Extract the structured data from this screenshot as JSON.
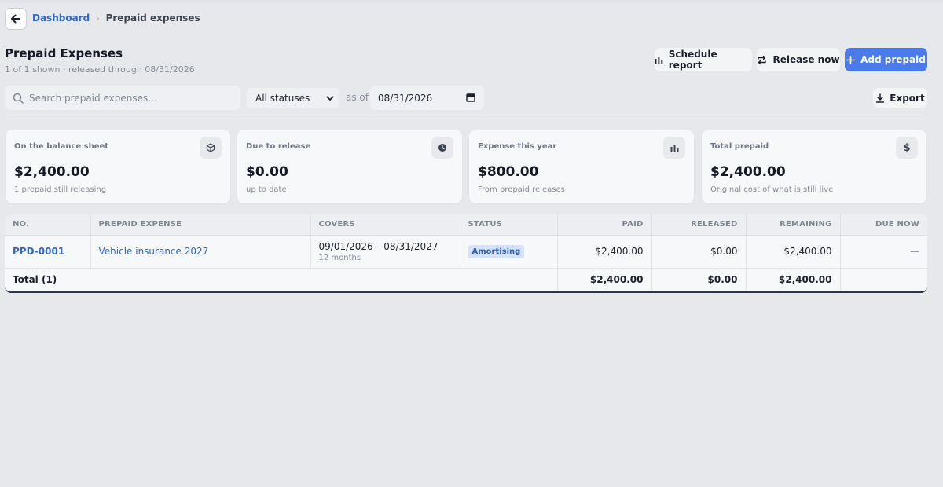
{
  "breadcrumb": {
    "root": "Dashboard",
    "separator": "›",
    "current": "Prepaid expenses"
  },
  "header": {
    "title": "Prepaid Expenses",
    "subtitle": "1 of 1 shown · released through 08/31/2026"
  },
  "actions": {
    "schedule_report": "Schedule report",
    "release_now": "Release now",
    "add_prepaid": "Add prepaid",
    "export": "Export"
  },
  "filters": {
    "search_placeholder": "Search prepaid expenses...",
    "status_selected": "All statuses",
    "as_of_label": "as of",
    "as_of_date": "08/31/2026"
  },
  "cards": [
    {
      "label": "On the balance sheet",
      "value": "$2,400.00",
      "note": "1 prepaid still releasing",
      "icon": "box-icon"
    },
    {
      "label": "Due to release",
      "value": "$0.00",
      "note": "up to date",
      "icon": "clock-icon"
    },
    {
      "label": "Expense this year",
      "value": "$800.00",
      "note": "From prepaid releases",
      "icon": "bar-chart-icon"
    },
    {
      "label": "Total prepaid",
      "value": "$2,400.00",
      "note": "Original cost of what is still live",
      "icon": "dollar-icon"
    }
  ],
  "table": {
    "columns": [
      "NO.",
      "PREPAID EXPENSE",
      "COVERS",
      "STATUS",
      "PAID",
      "RELEASED",
      "REMAINING",
      "DUE NOW"
    ],
    "rows": [
      {
        "no": "PPD-0001",
        "name": "Vehicle insurance 2027",
        "covers": "09/01/2026 – 08/31/2027",
        "covers_sub": "12 months",
        "status": "Amortising",
        "paid": "$2,400.00",
        "released": "$0.00",
        "remaining": "$2,400.00",
        "due_now": "—"
      }
    ],
    "total": {
      "label": "Total (1)",
      "paid": "$2,400.00",
      "released": "$0.00",
      "remaining": "$2,400.00"
    }
  },
  "colors": {
    "background": "#e6e8ec",
    "accent": "#4b7bea",
    "link": "#2f67c9",
    "status_pill_bg": "#d6e2fa",
    "status_pill_text": "#2f5fb8"
  }
}
